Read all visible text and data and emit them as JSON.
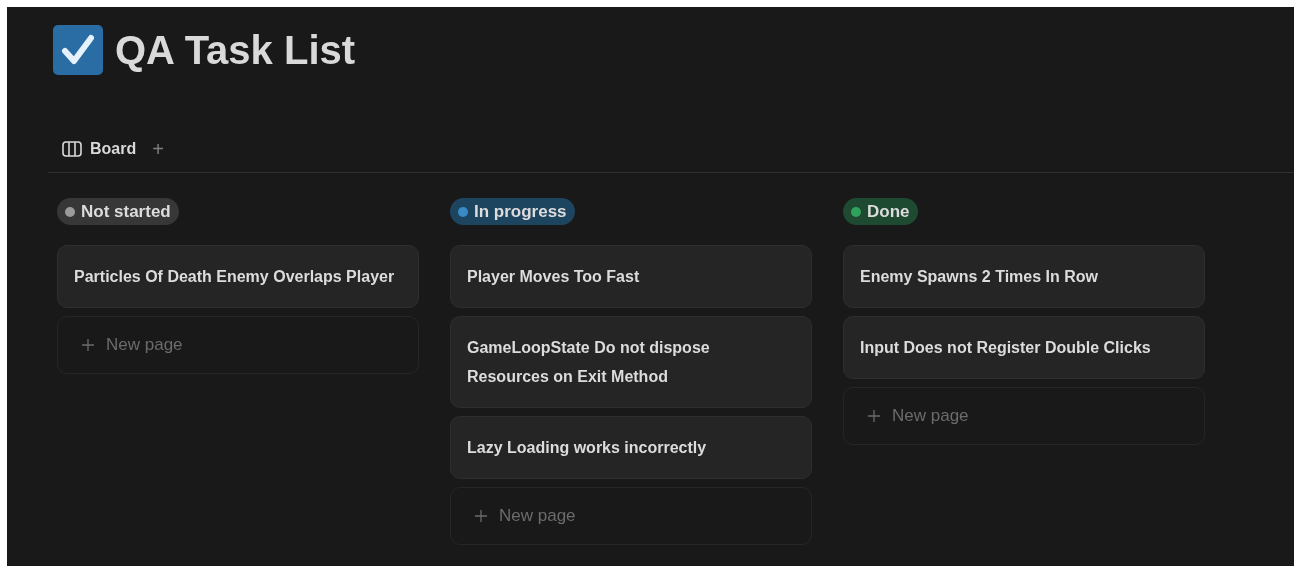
{
  "page": {
    "title": "QA Task List"
  },
  "view_tabs": [
    {
      "label": "Board",
      "selected": true
    }
  ],
  "add_view": "+",
  "columns": [
    {
      "status": "Not started",
      "color": "#9b9b9b",
      "cards": [
        "Particles Of Death Enemy Overlaps Player"
      ],
      "new_page": "New page"
    },
    {
      "status": "In progress",
      "color": "#3a8bc4",
      "cards": [
        "Player Moves Too Fast",
        "GameLoopState Do not dispose Resources on Exit Method",
        "Lazy Loading works incorrectly"
      ],
      "new_page": "New page"
    },
    {
      "status": "Done",
      "color": "#2fa35c",
      "cards": [
        "Enemy Spawns 2 Times In Row",
        "Input Does not Register Double Clicks"
      ],
      "new_page": "New page"
    }
  ]
}
